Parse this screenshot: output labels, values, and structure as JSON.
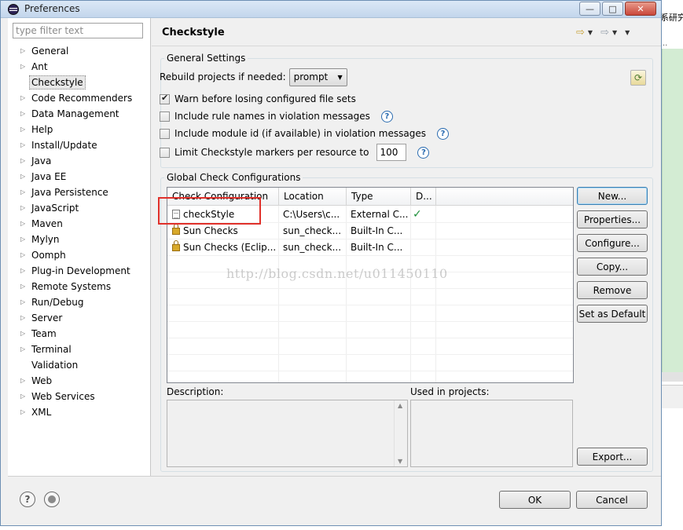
{
  "window": {
    "title": "Preferences"
  },
  "filter": {
    "placeholder": "type filter text"
  },
  "tree": [
    {
      "label": "General",
      "expandable": true
    },
    {
      "label": "Ant",
      "expandable": true
    },
    {
      "label": "Checkstyle",
      "expandable": false,
      "selected": true
    },
    {
      "label": "Code Recommenders",
      "expandable": true
    },
    {
      "label": "Data Management",
      "expandable": true
    },
    {
      "label": "Help",
      "expandable": true
    },
    {
      "label": "Install/Update",
      "expandable": true
    },
    {
      "label": "Java",
      "expandable": true
    },
    {
      "label": "Java EE",
      "expandable": true
    },
    {
      "label": "Java Persistence",
      "expandable": true
    },
    {
      "label": "JavaScript",
      "expandable": true
    },
    {
      "label": "Maven",
      "expandable": true
    },
    {
      "label": "Mylyn",
      "expandable": true
    },
    {
      "label": "Oomph",
      "expandable": true
    },
    {
      "label": "Plug-in Development",
      "expandable": true
    },
    {
      "label": "Remote Systems",
      "expandable": true
    },
    {
      "label": "Run/Debug",
      "expandable": true
    },
    {
      "label": "Server",
      "expandable": true
    },
    {
      "label": "Team",
      "expandable": true
    },
    {
      "label": "Terminal",
      "expandable": true
    },
    {
      "label": "Validation",
      "expandable": false
    },
    {
      "label": "Web",
      "expandable": true
    },
    {
      "label": "Web Services",
      "expandable": true
    },
    {
      "label": "XML",
      "expandable": true
    }
  ],
  "page": {
    "title": "Checkstyle"
  },
  "general_settings": {
    "legend": "General Settings",
    "rebuild_label": "Rebuild projects if needed:",
    "rebuild_value": "prompt",
    "warn_label": "Warn before losing configured file sets",
    "include_rule_label": "Include rule names in violation messages",
    "include_module_label": "Include module id (if available) in violation messages",
    "limit_label": "Limit Checkstyle markers per resource to",
    "limit_value": "100",
    "help_glyph": "?"
  },
  "global_configs": {
    "legend": "Global Check Configurations",
    "columns": [
      "Check Configuration",
      "Location",
      "Type",
      "D..."
    ],
    "rows": [
      {
        "name": "checkStyle",
        "location": "C:\\Users\\c...",
        "type": "External C...",
        "default": "✓",
        "icon": "file"
      },
      {
        "name": "Sun Checks",
        "location": "sun_check...",
        "type": "Built-In C...",
        "default": "",
        "icon": "lock"
      },
      {
        "name": "Sun Checks (Eclip...",
        "location": "sun_check...",
        "type": "Built-In C...",
        "default": "",
        "icon": "lock"
      }
    ],
    "buttons": {
      "new": "New...",
      "properties": "Properties...",
      "configure": "Configure...",
      "copy": "Copy...",
      "remove": "Remove",
      "set_default": "Set as Default",
      "export": "Export..."
    },
    "description_label": "Description:",
    "used_in_label": "Used in projects:"
  },
  "watermark": "http://blog.csdn.net/u011450110",
  "footer": {
    "ok": "OK",
    "cancel": "Cancel",
    "help_glyph": "?"
  },
  "colors": {
    "highlight": "#e0302a",
    "check": "#1d8f3a"
  }
}
